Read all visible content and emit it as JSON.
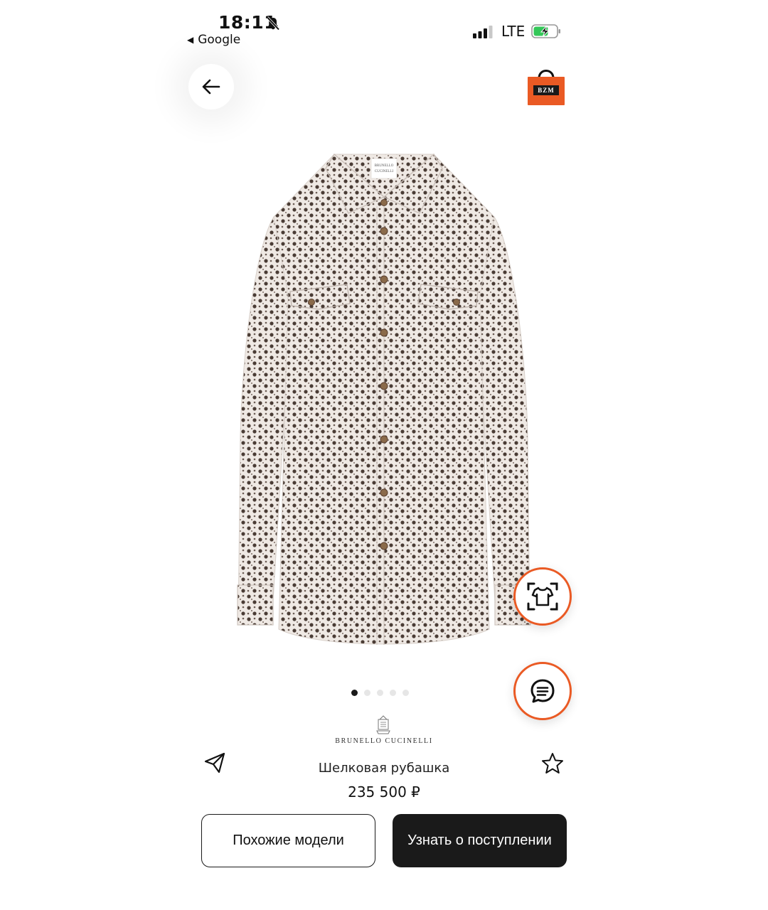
{
  "status_bar": {
    "time": "18:11",
    "back_app": "Google",
    "network": "LTE"
  },
  "header": {
    "store_logo_text": "BZM",
    "accent_color": "#ea5a24"
  },
  "gallery": {
    "total_images": 5,
    "current_index": 1,
    "shirt_brand_label_1": "BRUNELLO",
    "shirt_brand_label_2": "CUCINELLI"
  },
  "product": {
    "brand": "BRUNELLO CUCINELLI",
    "title": "Шелковая рубашка",
    "price": "235 500 ₽"
  },
  "actions": {
    "similar_label": "Похожие модели",
    "notify_label": "Узнать о поступлении"
  },
  "icons": {
    "back": "arrow-left-icon",
    "share": "paper-plane-icon",
    "favorite": "star-outline-icon",
    "try_on": "shirt-scan-icon",
    "chat": "chat-bubble-icon"
  }
}
